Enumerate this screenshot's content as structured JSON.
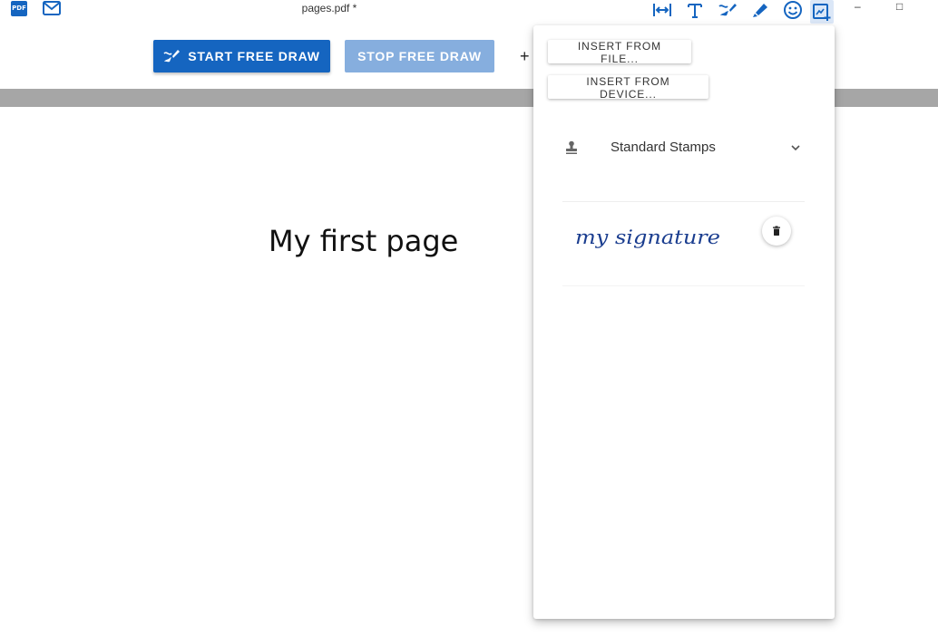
{
  "window": {
    "title": "pages.pdf *",
    "app_icon_text": "PDF",
    "minimize": "–",
    "maximize": "□"
  },
  "toolbar": {
    "icons": [
      "fit-width-icon",
      "text-icon",
      "free-draw-icon",
      "highlighter-icon",
      "emoji-icon",
      "insert-image-icon"
    ],
    "active_icon": "insert-image-icon",
    "accent_color": "#1565c0"
  },
  "draw": {
    "start_label": "START FREE DRAW",
    "stop_label": "STOP FREE DRAW",
    "plus": "+"
  },
  "document": {
    "heading": "My first page"
  },
  "panel": {
    "insert_file_label": "INSERT FROM FILE...",
    "insert_device_label": "INSERT FROM DEVICE...",
    "stamps_label": "Standard Stamps",
    "signature_text": "my signature",
    "signature_color": "#1a3d8f"
  }
}
